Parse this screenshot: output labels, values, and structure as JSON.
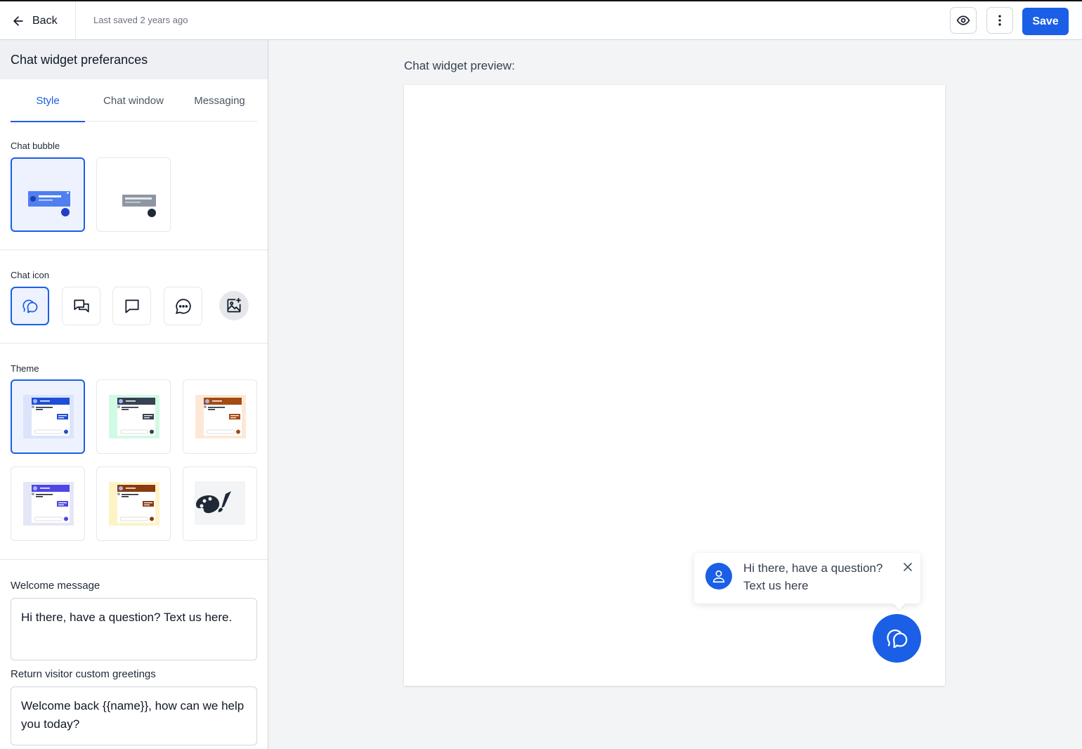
{
  "topbar": {
    "back_label": "Back",
    "saved_text": "Last saved 2 years ago",
    "preview_icon": "eye-icon",
    "more_icon": "vertical-dots-icon",
    "save_label": "Save"
  },
  "sidebar": {
    "title": "Chat widget preferances",
    "tabs": [
      {
        "label": "Style",
        "active": true
      },
      {
        "label": "Chat window",
        "active": false
      },
      {
        "label": "Messaging",
        "active": false
      }
    ],
    "chat_bubble": {
      "label": "Chat bubble",
      "options": [
        {
          "name": "bubble-style-blue",
          "selected": true
        },
        {
          "name": "bubble-style-gray",
          "selected": false
        }
      ]
    },
    "chat_icon": {
      "label": "Chat icon",
      "options": [
        {
          "icon": "chat-bubbles-outline-icon",
          "selected": true
        },
        {
          "icon": "chat-conversation-icon",
          "selected": false
        },
        {
          "icon": "chat-square-icon",
          "selected": false
        },
        {
          "icon": "chat-dots-icon",
          "selected": false
        },
        {
          "icon": "image-add-icon",
          "selected": false
        }
      ]
    },
    "theme": {
      "label": "Theme",
      "options": [
        {
          "name": "theme-blue",
          "bg": "#dbe4fb",
          "header": "#1f4ed8",
          "selected": true
        },
        {
          "name": "theme-mint",
          "bg": "#d1fae5",
          "header": "#374151",
          "selected": false
        },
        {
          "name": "theme-peach",
          "bg": "#fde8d7",
          "header": "#a44b12",
          "selected": false
        },
        {
          "name": "theme-purple",
          "bg": "#e5e7f6",
          "header": "#4f46e5",
          "selected": false
        },
        {
          "name": "theme-yellow",
          "bg": "#fef3c7",
          "header": "#8a3b10",
          "selected": false
        },
        {
          "name": "theme-custom",
          "icon": "palette-icon",
          "selected": false
        }
      ]
    },
    "welcome_message": {
      "label": "Welcome message",
      "value": "Hi there, have a question? Text us here."
    },
    "return_greeting": {
      "label": "Return visitor custom greetings",
      "value": "Welcome back {{name}}, how can we help you today?"
    }
  },
  "preview": {
    "title": "Chat widget preview:",
    "popup_text_line1": "Hi there, have a question?",
    "popup_text_line2": "Text us here",
    "avatar_icon": "user-icon",
    "close_icon": "close-icon",
    "launcher_icon": "chat-bubbles-outline-icon"
  },
  "colors": {
    "accent": "#1a5fe6",
    "selected_bg": "#eef2ff",
    "canvas_bg": "#f3f4f6"
  }
}
